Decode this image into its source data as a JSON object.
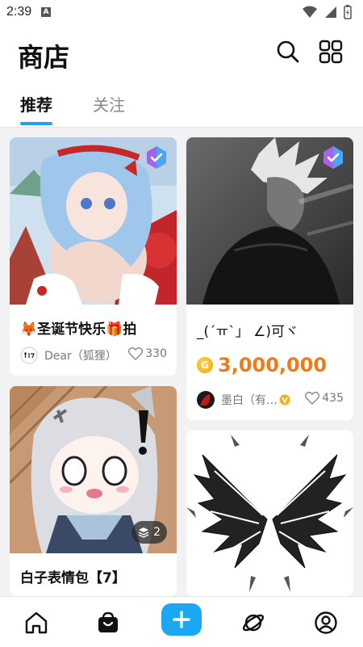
{
  "status_bar": {
    "time": "2:39"
  },
  "header": {
    "title": "商店"
  },
  "tabs": [
    {
      "label": "推荐"
    },
    {
      "label": "关注"
    }
  ],
  "cards": [
    {
      "name": "🦊圣诞节快乐🎁拍",
      "author": "Dear（狐狸）",
      "likes": "330"
    },
    {
      "name": "_(´ㅠ`」 ∠)可ヾ",
      "price": "3,000,000",
      "author": "墨白（有…",
      "likes": "435"
    },
    {
      "name": "白子表情包【7】",
      "image_count": "2"
    },
    {
      "name": ""
    }
  ],
  "colors": {
    "accent": "#1aa3f0",
    "price": "#f07a1a"
  },
  "bottom_nav": [
    {
      "icon": "home-icon"
    },
    {
      "icon": "shop-bag-icon"
    },
    {
      "icon": "plus-icon"
    },
    {
      "icon": "planet-icon"
    },
    {
      "icon": "profile-icon"
    }
  ]
}
